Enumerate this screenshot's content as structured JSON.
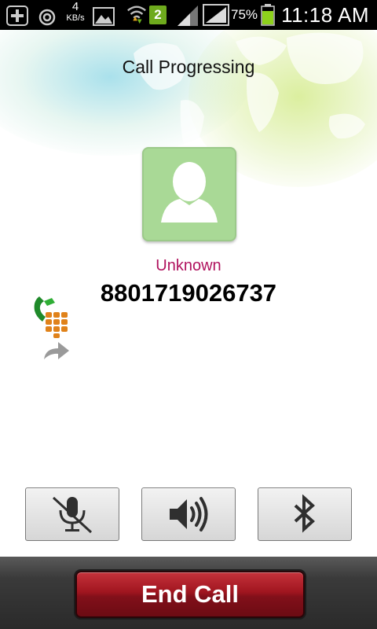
{
  "status_bar": {
    "kbs_value": "4",
    "kbs_unit": "KB/s",
    "sim_badge": "2",
    "battery_percent": "75%",
    "time": "11:18 AM",
    "icons": [
      "add-icon",
      "sync-icon",
      "image-icon",
      "wifi-icon",
      "signal-icon",
      "battery-icon"
    ]
  },
  "call": {
    "title": "Call Progressing",
    "caller_name": "Unknown",
    "caller_number": "8801719026737",
    "colors": {
      "caller_name": "#b0125e",
      "avatar_bg": "#a9d996",
      "end_call": "#a0151f"
    }
  },
  "controls": {
    "buttons": [
      {
        "icon": "microphone-muted-icon"
      },
      {
        "icon": "speaker-icon"
      },
      {
        "icon": "bluetooth-icon"
      }
    ]
  },
  "footer": {
    "end_call_label": "End Call"
  }
}
